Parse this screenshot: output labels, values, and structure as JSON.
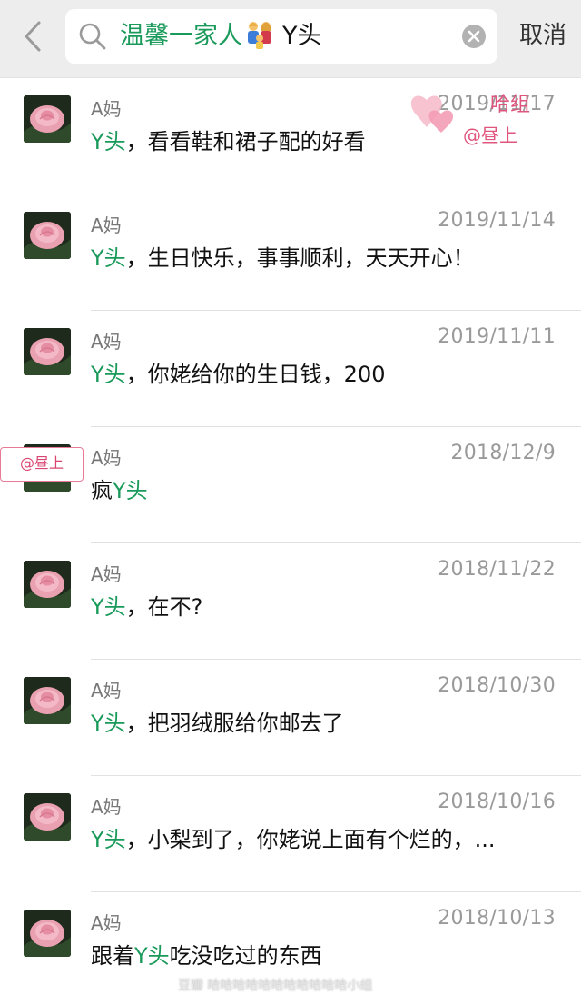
{
  "search": {
    "query_part1": "温馨一家人",
    "query_part2": "Y头",
    "cancel_label": "取消"
  },
  "results": [
    {
      "sender": "A妈",
      "date": "2019/11/17",
      "pre": "",
      "hl": "Y头",
      "post": "，看看鞋和裙子配的好看"
    },
    {
      "sender": "A妈",
      "date": "2019/11/14",
      "pre": "",
      "hl": "Y头",
      "post": "，生日快乐，事事顺利，天天开心！"
    },
    {
      "sender": "A妈",
      "date": "2019/11/11",
      "pre": "",
      "hl": "Y头",
      "post": "，你姥给你的生日钱，200"
    },
    {
      "sender": "A妈",
      "date": "2018/12/9",
      "pre": "疯",
      "hl": "Y头",
      "post": ""
    },
    {
      "sender": "A妈",
      "date": "2018/11/22",
      "pre": "",
      "hl": "Y头",
      "post": "，在不?"
    },
    {
      "sender": "A妈",
      "date": "2018/10/30",
      "pre": "",
      "hl": "Y头",
      "post": "，把羽绒服给你邮去了"
    },
    {
      "sender": "A妈",
      "date": "2018/10/16",
      "pre": "",
      "hl": "Y头",
      "post": "，小梨到了，你姥说上面有个烂的，..."
    },
    {
      "sender": "A妈",
      "date": "2018/10/13",
      "pre": "跟着",
      "hl": "Y头",
      "post": "吃没吃过的东西"
    }
  ],
  "stickers": {
    "top_line1": "哈组",
    "top_line2": "@昼上",
    "left": "@昼上"
  },
  "watermark": "豆瓣  哈哈哈哈哈哈哈哈哈哈哈小组",
  "colors": {
    "highlight": "#1a9a5a",
    "header_bg": "#ededed",
    "sticker_pink": "#e87a97"
  },
  "icons": {
    "back": "chevron-left-icon",
    "search": "search-icon",
    "clear": "clear-icon",
    "family_emoji": "family-emoji-icon",
    "avatar": "pink-rose-avatar"
  }
}
